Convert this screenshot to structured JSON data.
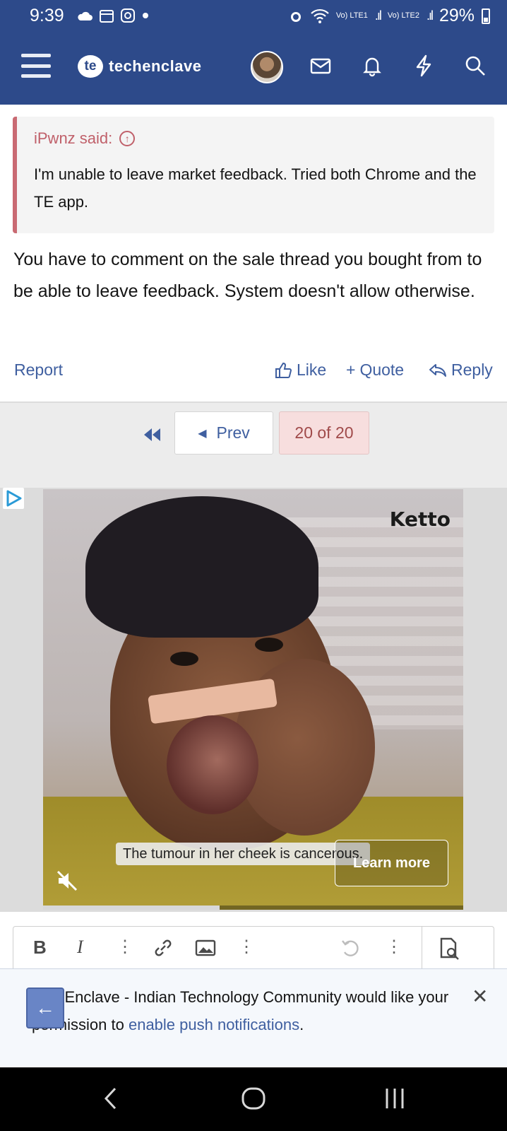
{
  "status_bar": {
    "time": "9:39",
    "sim1": "Vo) LTE1",
    "sim2": "Vo) LTE2",
    "battery": "29%"
  },
  "header": {
    "logo_badge": "te",
    "logo_text": "techenclave",
    "icons": [
      "menu-icon",
      "avatar",
      "mail-icon",
      "bell-icon",
      "lightning-icon",
      "search-icon"
    ],
    "bg_color": "#2d4a8a"
  },
  "quote": {
    "author": "iPwnz said:",
    "body": "I'm unable to leave market feedback. Tried both Chrome and the TE app."
  },
  "post": {
    "message": "You have to comment on the sale thread you bought from to be able to leave feedback. System doesn't allow otherwise."
  },
  "actions": {
    "report": "Report",
    "like": "Like",
    "quote": "Quote",
    "reply": "Reply"
  },
  "pagination": {
    "prev": "Prev",
    "current": "20 of 20"
  },
  "ad": {
    "brand": "Ketto",
    "caption": "The tumour in her cheek is cancerous.",
    "cta": "Learn more",
    "video_progress": 0.42
  },
  "editor": {
    "bold": "B",
    "italic": "I"
  },
  "notification": {
    "pre_text": "TechEnclave - Indian Technology Community would like your permission to",
    "link_text": "enable push notifications",
    "post_text": "."
  }
}
